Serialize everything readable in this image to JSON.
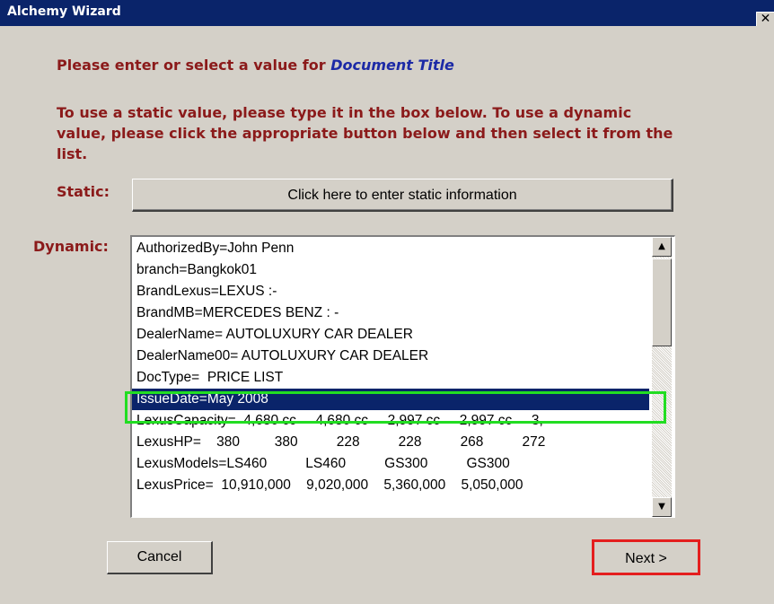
{
  "window": {
    "title": "Alchemy Wizard",
    "close_glyph": "✕"
  },
  "prompt": {
    "text": "Please enter or select a value for ",
    "field_name": "Document Title"
  },
  "instructions": "To use a static value, please type it in the box below.  To use a dynamic value, please click the appropriate button below and then select it from the list.",
  "static": {
    "label": "Static:",
    "button_label": "Click here to enter static information"
  },
  "dynamic": {
    "label": "Dynamic:",
    "items": [
      "AuthorizedBy=John Penn",
      "branch=Bangkok01",
      "BrandLexus=LEXUS :-",
      "BrandMB=MERCEDES BENZ : -",
      "DealerName= AUTOLUXURY CAR DEALER",
      "DealerName00= AUTOLUXURY CAR DEALER",
      "DocType=  PRICE LIST",
      "IssueDate=May 2008",
      "LexusCapacity=  4,680 cc     4,680 cc     2,997 cc     2,997 cc     3,",
      "LexusHP=    380         380          228          228          268          272",
      "LexusModels=LS460          LS460          GS300          GS300",
      "LexusPrice=  10,910,000    9,020,000    5,360,000    5,050,000"
    ],
    "selected_index": 7
  },
  "buttons": {
    "cancel": "Cancel",
    "next": "Next >"
  },
  "colors": {
    "accent_selected": "#0a246a",
    "label_text": "#8b1a1a",
    "field_name": "#1c2aa6",
    "highlight_green": "#22dd22",
    "highlight_red": "#e41e1e"
  },
  "icons": {
    "scroll_up": "▲",
    "scroll_down": "▼"
  }
}
